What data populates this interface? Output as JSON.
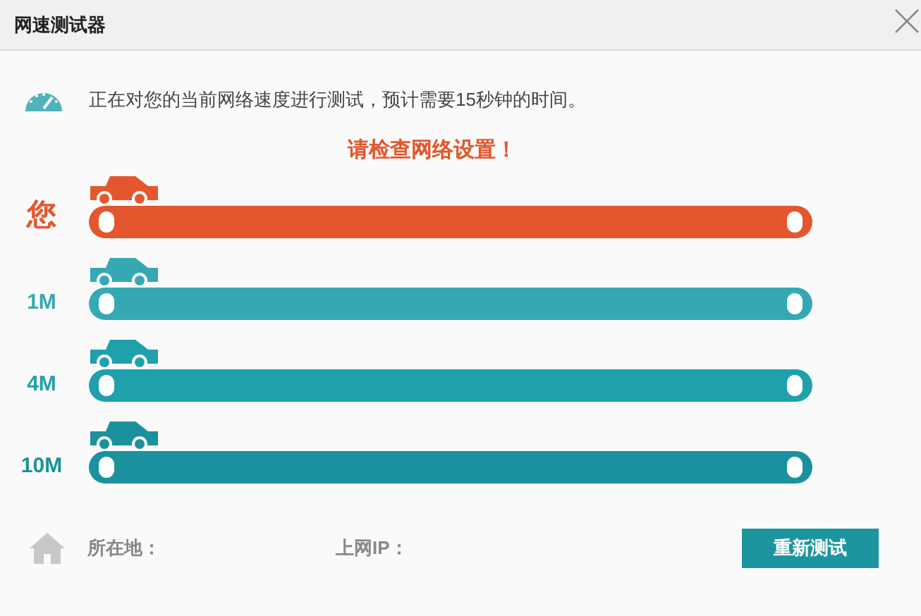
{
  "window": {
    "title": "网速测试器"
  },
  "intro": "正在对您的当前网络速度进行测试，预计需要15秒钟的时间。",
  "warning": "请检查网络设置！",
  "lanes": [
    {
      "label": "您",
      "color": "#e4572e"
    },
    {
      "label": "1M",
      "color": "#35a9b3"
    },
    {
      "label": "4M",
      "color": "#1fa0ad"
    },
    {
      "label": "10M",
      "color": "#1a919c"
    }
  ],
  "footer": {
    "location_label": "所在地：",
    "ip_label": "上网IP：",
    "retest_button": "重新测试"
  }
}
